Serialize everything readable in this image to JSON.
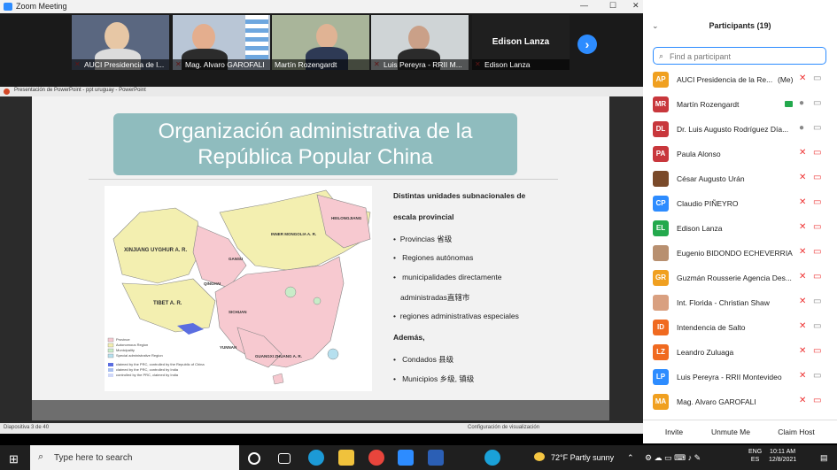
{
  "window": {
    "title": "Zoom Meeting"
  },
  "gallery": {
    "tiles": [
      {
        "name": "AUCI Presidencia de l..."
      },
      {
        "name": "Mag. Alvaro GAROFALI"
      },
      {
        "name": "Martín Rozengardt"
      },
      {
        "name": "Luis Pereyra - RRII M..."
      },
      {
        "name": "Edison Lanza",
        "big_name": "Edison Lanza"
      }
    ]
  },
  "ppt": {
    "title": "Presentación de PowerPoint - ppt uruguay - PowerPoint",
    "status_left": "Diapositiva 3 de 40",
    "status_right": "Configuración de visualización"
  },
  "slide": {
    "title_line1": "Organización administrativa de la",
    "title_line2": "República Popular China",
    "map": {
      "regions": [
        "XINJIANG UYGHUR A. R.",
        "TIBET A. R.",
        "INNER MONGOLIA A. R.",
        "HEILONGJIANG",
        "QINGHAI",
        "GANSU",
        "SICHUAN",
        "YUNNAN",
        "GUANGXI ZHUANG A. R."
      ],
      "legend": [
        "Province",
        "Autonomous Region",
        "Municipality",
        "Special administrative Region",
        "claimed by the PRC, controlled by the Republic of China",
        "claimed by the PRC, controlled by India",
        "controlled by the PRC, claimed by India"
      ]
    },
    "heading_line1": "Distintas unidades subnacionales de",
    "heading_line2": "escala provincial",
    "b1": "Provincias 省级",
    "b2": "Regiones autónomas",
    "b3_line1": "municipalidades directamente",
    "b3_line2": "administradas直辖市",
    "b4": "regiones administrativas especiales",
    "ademas": "Además,",
    "b5": "Condados 县级",
    "b6": "Municipios 乡级, 镇级"
  },
  "panel": {
    "header": "Participants (19)",
    "search_placeholder": "Find a participant",
    "participants": [
      {
        "initials": "AP",
        "name": "AUCI Presidencia de la Re...",
        "me": "(Me)",
        "color": "#f0a020"
      },
      {
        "initials": "MR",
        "name": "Martín Rozengardt",
        "color": "#c8373c"
      },
      {
        "initials": "DL",
        "name": "Dr. Luis Augusto Rodríguez Día...",
        "color": "#c8373c"
      },
      {
        "initials": "PA",
        "name": "Paula Alonso",
        "color": "#c8373c"
      },
      {
        "initials": "",
        "name": "César Augusto Urán",
        "color": "#7a4a2a"
      },
      {
        "initials": "CP",
        "name": "Claudio PIÑEYRO",
        "color": "#2d8cff"
      },
      {
        "initials": "EL",
        "name": "Edison Lanza",
        "color": "#23a94d"
      },
      {
        "initials": "",
        "name": "Eugenio BIDONDO ECHEVERRIA",
        "color": "#b89070"
      },
      {
        "initials": "GR",
        "name": "Guzmán Rousserie Agencia Des...",
        "color": "#f0a020"
      },
      {
        "initials": "",
        "name": "Int. Florida - Christian Shaw",
        "color": "#d9a080"
      },
      {
        "initials": "ID",
        "name": "Intendencia de Salto",
        "color": "#f06a20"
      },
      {
        "initials": "LZ",
        "name": "Leandro Zuluaga",
        "color": "#f06a20"
      },
      {
        "initials": "LP",
        "name": "Luis Pereyra - RRII Montevideo",
        "color": "#2d8cff"
      },
      {
        "initials": "MA",
        "name": "Mag. Alvaro GAROFALI",
        "color": "#f0a020"
      }
    ],
    "buttons": {
      "invite": "Invite",
      "unmute": "Unmute Me",
      "claim": "Claim Host"
    }
  },
  "taskbar": {
    "search_placeholder": "Type here to search",
    "weather": "72°F  Partly sunny",
    "lang1": "ENG",
    "lang2": "ES",
    "time": "10:11 AM",
    "date": "12/8/2021"
  }
}
